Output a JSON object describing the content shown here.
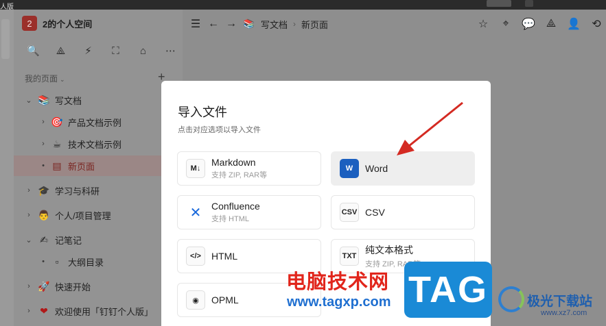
{
  "app": {
    "title_fragment": "人版"
  },
  "sidebar": {
    "workspace_badge": "2",
    "workspace_name": "2的个人空间",
    "tools": [
      {
        "icon": "search-icon",
        "glyph": "🔍"
      },
      {
        "icon": "graph-icon",
        "glyph": "⟁"
      },
      {
        "icon": "flash-icon",
        "glyph": "⚡"
      },
      {
        "icon": "frame-icon",
        "glyph": "⛶"
      },
      {
        "icon": "inbox-icon",
        "glyph": "⌂"
      },
      {
        "icon": "more-icon",
        "glyph": "⋯"
      }
    ],
    "section_label": "我的页面",
    "add_glyph": "+",
    "items": [
      {
        "label": "写文档",
        "icon": "doc-stack-icon",
        "glyph": "📚",
        "arrow": "⌄"
      },
      {
        "label": "产品文档示例",
        "icon": "target-icon",
        "glyph": "🎯",
        "arrow": "›"
      },
      {
        "label": "技术文档示例",
        "icon": "coffee-icon",
        "glyph": "☕",
        "arrow": "›"
      },
      {
        "label": "新页面",
        "icon": "page-icon",
        "glyph": "▤",
        "arrow": "•"
      },
      {
        "label": "学习与科研",
        "icon": "grad-cap-icon",
        "glyph": "🎓",
        "arrow": "›"
      },
      {
        "label": "个人/项目管理",
        "icon": "person-icon",
        "glyph": "👨",
        "arrow": "›"
      },
      {
        "label": "记笔记",
        "icon": "pen-icon",
        "glyph": "✍",
        "arrow": "⌄"
      },
      {
        "label": "大纲目录",
        "icon": "outline-icon",
        "glyph": "▫",
        "arrow": "•"
      },
      {
        "label": "快速开始",
        "icon": "rocket-icon",
        "glyph": "🚀",
        "arrow": "›"
      },
      {
        "label": "欢迎使用「钉钉个人版」",
        "icon": "heart-icon",
        "glyph": "❤",
        "arrow": "›"
      }
    ]
  },
  "header": {
    "menu_glyph": "☰",
    "back_glyph": "←",
    "forward_glyph": "→",
    "crumb_parent": "写文档",
    "crumb_sep": "›",
    "crumb_current": "新页面",
    "actions": [
      {
        "icon": "star-icon",
        "glyph": "☆"
      },
      {
        "icon": "pin-icon",
        "glyph": "⌖"
      },
      {
        "icon": "comment-icon",
        "glyph": "💬"
      },
      {
        "icon": "share-graph-icon",
        "glyph": "⟁"
      },
      {
        "icon": "add-member-icon",
        "glyph": "👤"
      },
      {
        "icon": "history-icon",
        "glyph": "⟲"
      }
    ]
  },
  "modal": {
    "title": "导入文件",
    "subtitle": "点击对应选项以导入文件",
    "options": [
      {
        "name": "Markdown",
        "desc": "支持 ZIP, RAR等",
        "icon_text": "M↓"
      },
      {
        "name": "Word",
        "desc": "",
        "icon_text": "W"
      },
      {
        "name": "Confluence",
        "desc": "支持 HTML",
        "icon_text": "✕"
      },
      {
        "name": "CSV",
        "desc": "",
        "icon_text": "CSV"
      },
      {
        "name": "HTML",
        "desc": "",
        "icon_text": "</>"
      },
      {
        "name": "纯文本格式",
        "desc": "支持 ZIP, RAR等",
        "icon_text": "TXT"
      },
      {
        "name": "OPML",
        "desc": "",
        "icon_text": "◉"
      }
    ]
  },
  "watermark": {
    "site_cn": "电脑技术网",
    "site_url": "www.tagxp.com",
    "tag": "TAG",
    "xz_name": "极光下载站",
    "xz_url": "www.xz7.com"
  },
  "colors": {
    "arrow_red": "#d42a22",
    "selected_text": "#7a2520",
    "word_blue": "#1b5fbf"
  }
}
